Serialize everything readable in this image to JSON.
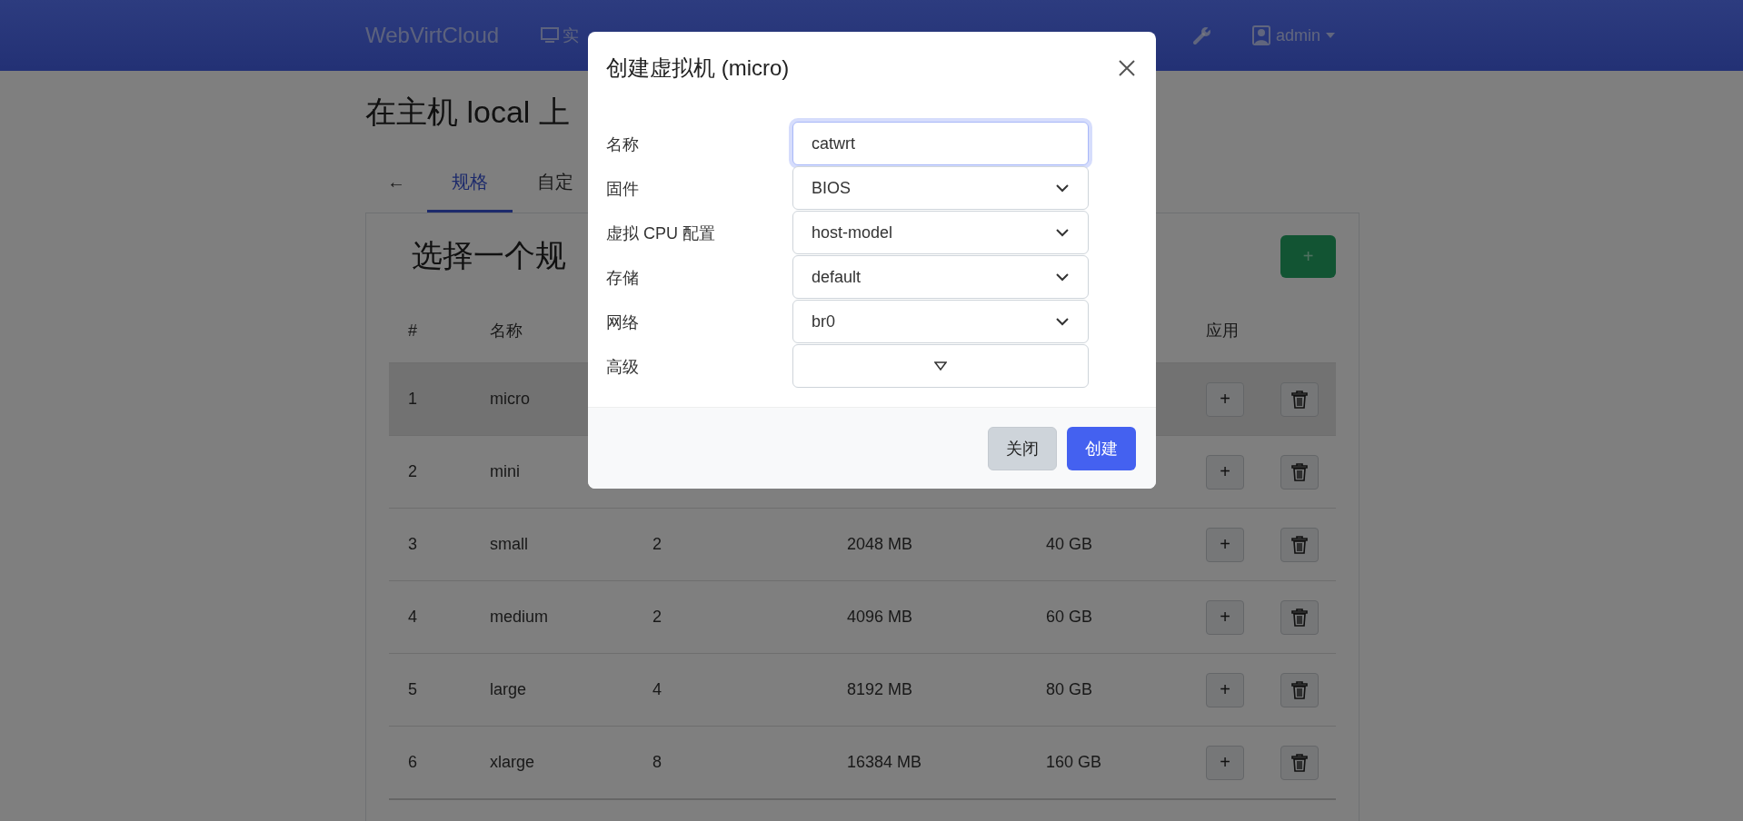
{
  "navbar": {
    "brand": "WebVirtCloud",
    "links": [
      {
        "label": "实"
      }
    ],
    "user": "admin"
  },
  "page": {
    "title": "在主机 local 上",
    "tabs": [
      {
        "label": "←",
        "selected": false
      },
      {
        "label": "规格",
        "selected": true
      },
      {
        "label": "自定",
        "selected": false
      }
    ]
  },
  "card": {
    "title": "选择一个规",
    "add_button": "+",
    "columns": [
      {
        "label": "#"
      },
      {
        "label": "名称"
      },
      {
        "label": "应用"
      }
    ],
    "rows": [
      {
        "number": "1",
        "name": "micro",
        "apply": "+",
        "selected": true
      },
      {
        "number": "2",
        "name": "mini",
        "apply": "+",
        "selected": false
      },
      {
        "number": "3",
        "name": "small",
        "vcpu": "2",
        "memory": "2048 MB",
        "hdd": "40 GB",
        "apply": "+",
        "selected": false
      },
      {
        "number": "4",
        "name": "medium",
        "vcpu": "2",
        "memory": "4096 MB",
        "hdd": "60 GB",
        "apply": "+",
        "selected": false
      },
      {
        "number": "5",
        "name": "large",
        "vcpu": "4",
        "memory": "8192 MB",
        "hdd": "80 GB",
        "apply": "+",
        "selected": false
      },
      {
        "number": "6",
        "name": "xlarge",
        "vcpu": "8",
        "memory": "16384 MB",
        "hdd": "160 GB",
        "apply": "+",
        "selected": false
      }
    ]
  },
  "modal": {
    "title": "创建虚拟机 (micro)",
    "fields": [
      {
        "label": "名称",
        "kind": "text",
        "value": "catwrt",
        "focused": true
      },
      {
        "label": "固件",
        "kind": "select",
        "value": "BIOS"
      },
      {
        "label": "虚拟 CPU 配置",
        "kind": "select",
        "value": "host-model"
      },
      {
        "label": "存储",
        "kind": "select",
        "value": "default"
      },
      {
        "label": "网络",
        "kind": "select",
        "value": "br0"
      },
      {
        "label": "高级",
        "kind": "toggle",
        "expanded": false
      }
    ],
    "buttons": [
      {
        "label": "关闭",
        "kind": "secondary"
      },
      {
        "label": "创建",
        "kind": "primary"
      }
    ]
  }
}
